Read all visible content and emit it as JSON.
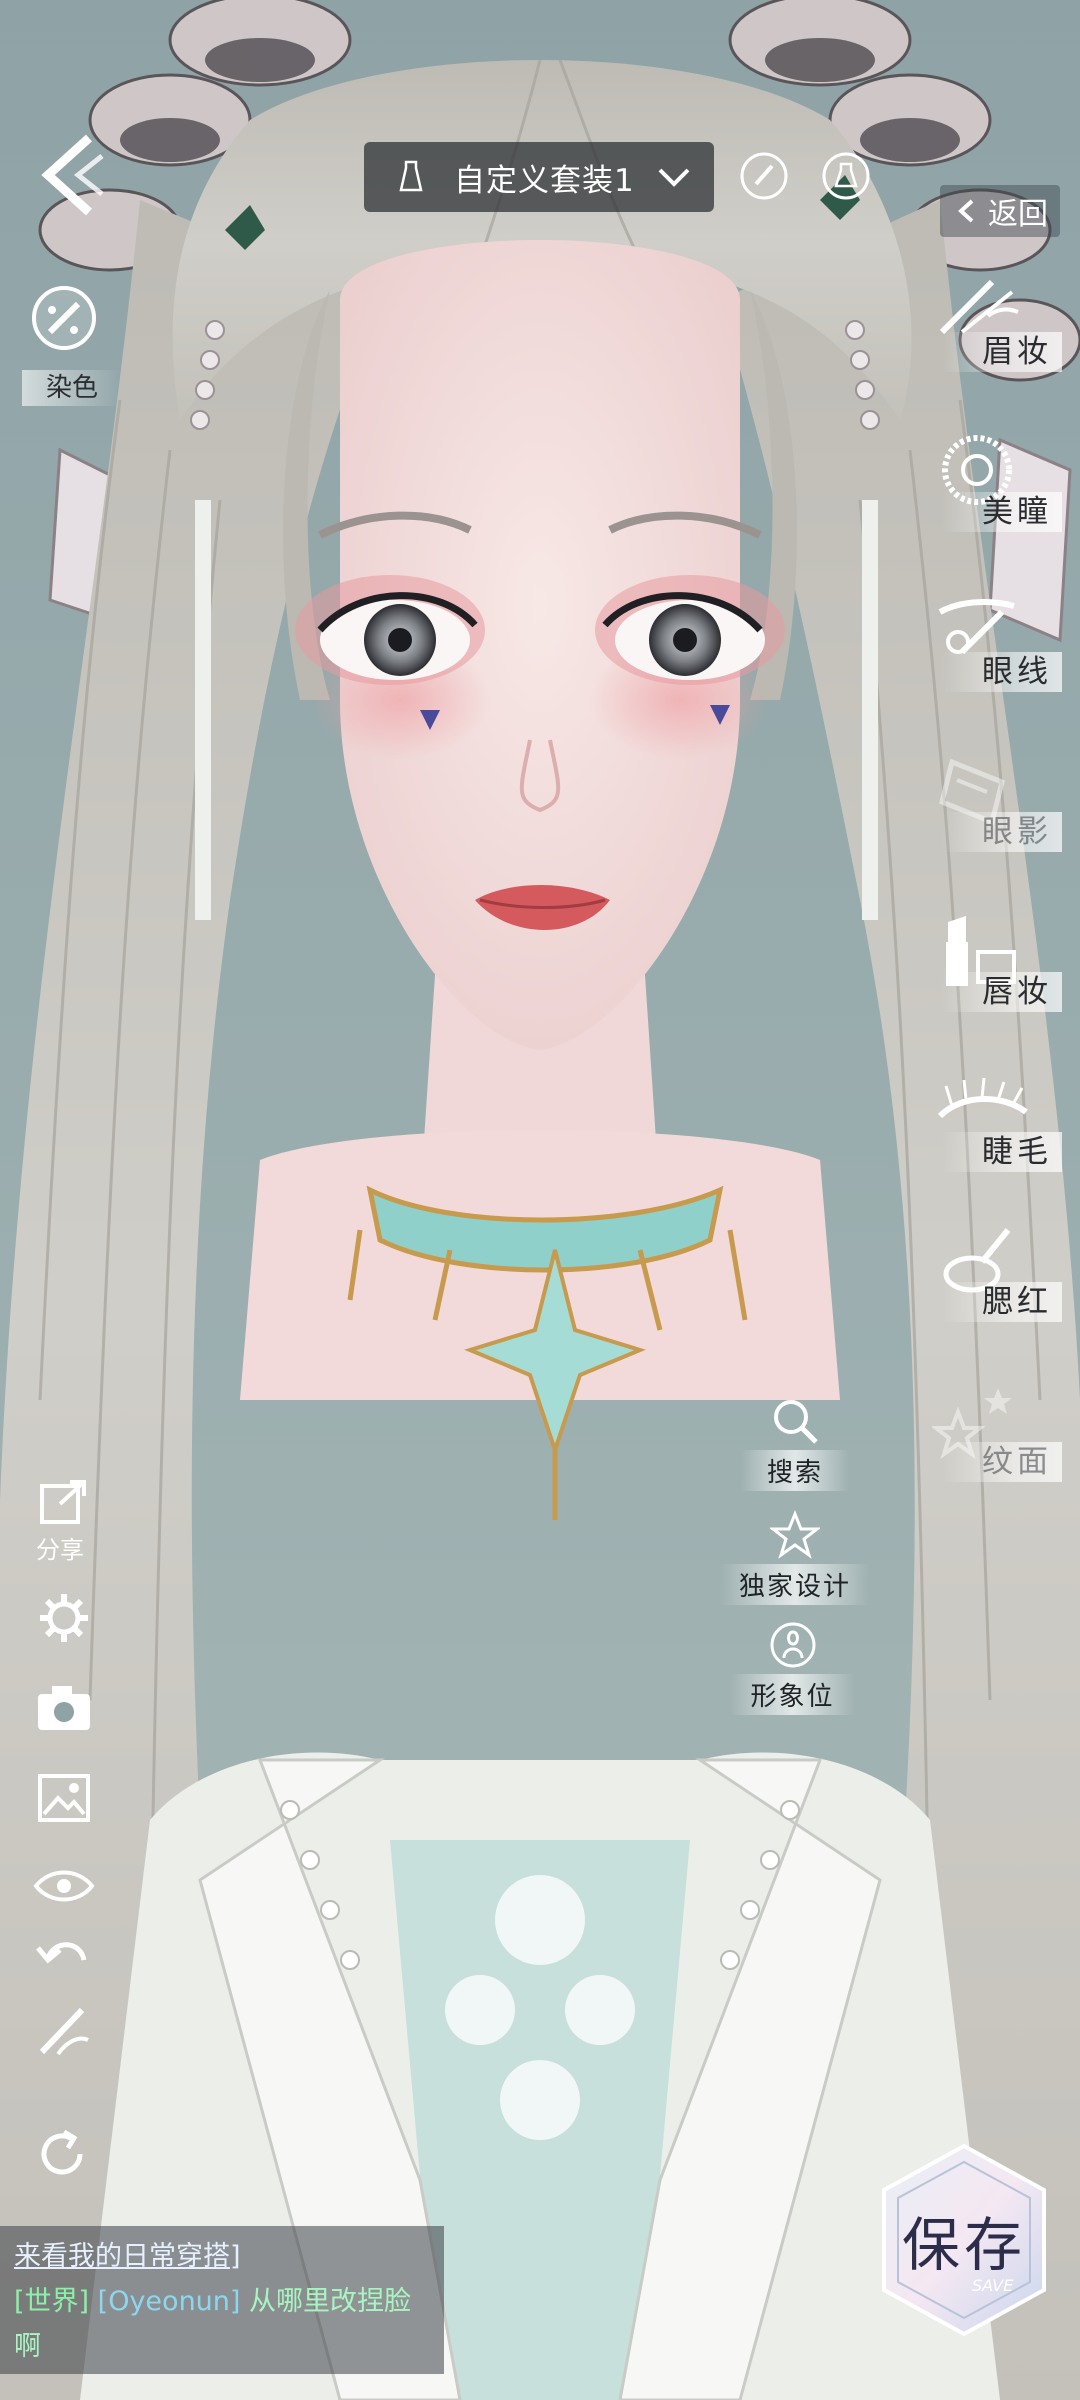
{
  "top_bar": {
    "outfit_name": "自定义套装1",
    "return_label": "返回"
  },
  "left_tools": {
    "dye_label": "染色",
    "share_label": "分享"
  },
  "makeup_menu": [
    {
      "label": "眉妆",
      "icon": "eyebrow-brush-icon"
    },
    {
      "label": "美瞳",
      "icon": "contact-lens-icon"
    },
    {
      "label": "眼线",
      "icon": "eyeliner-icon"
    },
    {
      "label": "眼影",
      "icon": "eyeshadow-palette-icon"
    },
    {
      "label": "唇妆",
      "icon": "lipstick-icon"
    },
    {
      "label": "睫毛",
      "icon": "eyelash-icon"
    },
    {
      "label": "腮红",
      "icon": "blush-icon"
    },
    {
      "label": "纹面",
      "icon": "face-tattoo-stars-icon"
    }
  ],
  "actions": {
    "search": "搜索",
    "exclusive_design": "独家设计",
    "image_slot": "形象位"
  },
  "chat": {
    "line1": "来看我的日常穿搭]",
    "channel": "[世界]",
    "user": "[Oyeonun]",
    "message": "从哪里改捏脸",
    "message_cont": "啊"
  },
  "save": {
    "label": "保存",
    "label_en": "SAVE"
  },
  "colors": {
    "background": "#8fa3a6",
    "hair": "#c9c7c0",
    "skin": "#f2dcdc",
    "necklace": "#9fd8d4"
  }
}
